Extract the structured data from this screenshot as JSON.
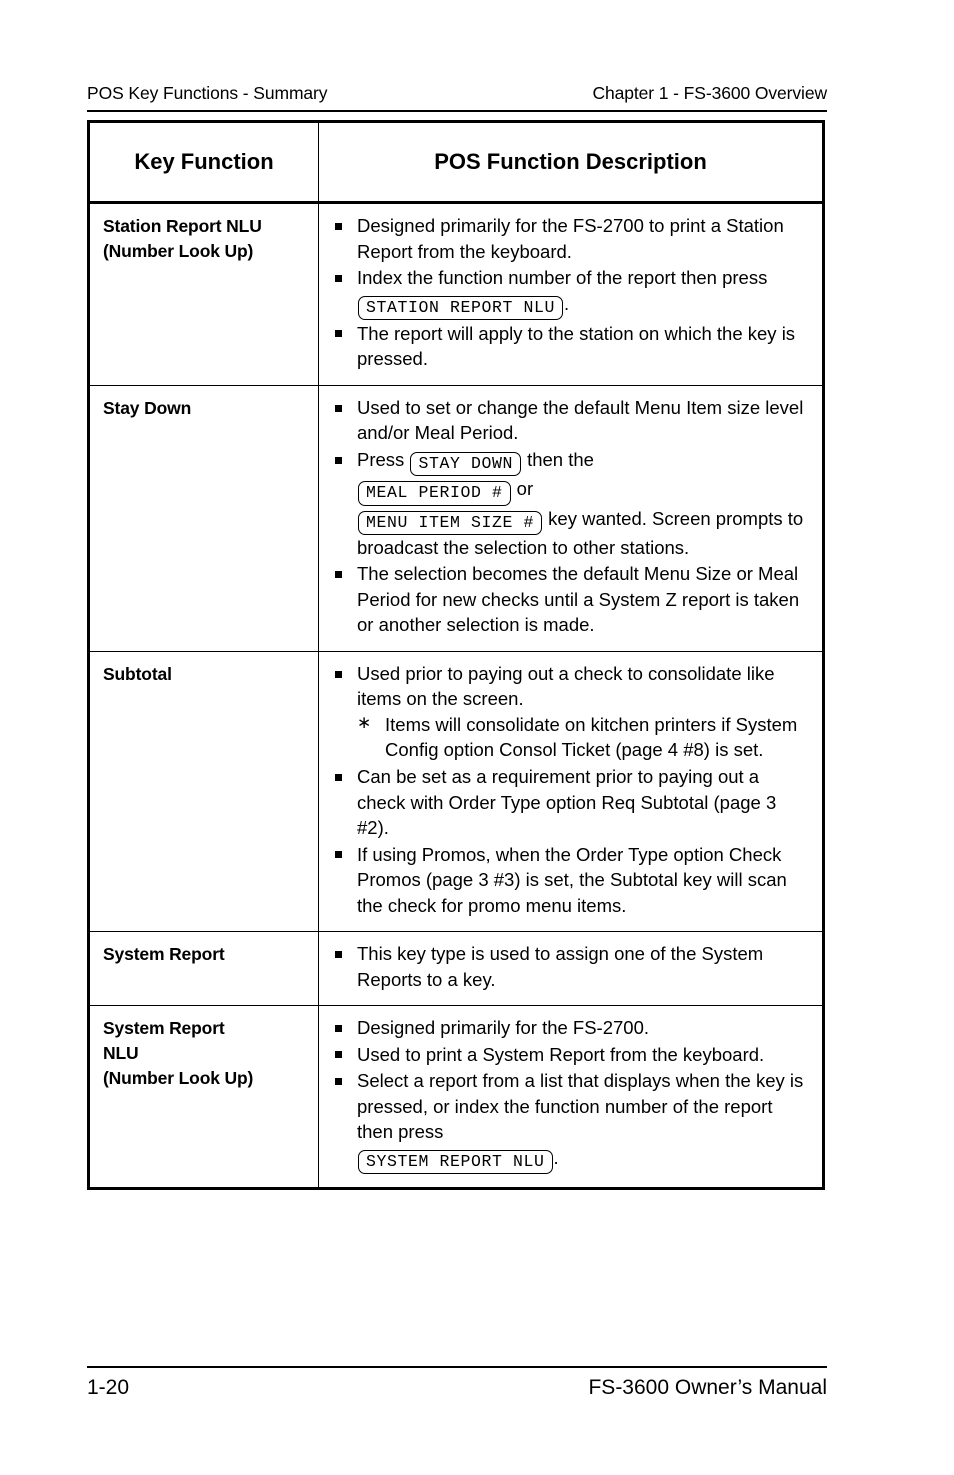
{
  "header": {
    "left": "POS Key Functions - Summary",
    "right": "Chapter 1 - FS-3600 Overview"
  },
  "table": {
    "columns": [
      "Key Function",
      "POS Function Description"
    ],
    "rows": [
      {
        "key_lines": [
          "Station Report NLU",
          "(Number Look Up)"
        ],
        "bullets": [
          {
            "type": "square",
            "segments": [
              {
                "t": "text",
                "v": "Designed primarily for the FS-2700 to print a Station Report from the keyboard."
              }
            ]
          },
          {
            "type": "square",
            "segments": [
              {
                "t": "text",
                "v": "Index the function number of the report then press "
              },
              {
                "t": "keycap",
                "v": "STATION REPORT NLU"
              },
              {
                "t": "text",
                "v": "."
              }
            ]
          },
          {
            "type": "square",
            "segments": [
              {
                "t": "text",
                "v": "The report will apply to the station on which the key is pressed."
              }
            ]
          }
        ]
      },
      {
        "key_lines": [
          "Stay Down"
        ],
        "bullets": [
          {
            "type": "square",
            "segments": [
              {
                "t": "text",
                "v": "Used to set or change the default Menu Item size level and/or Meal Period."
              }
            ]
          },
          {
            "type": "square",
            "segments": [
              {
                "t": "text",
                "v": "Press "
              },
              {
                "t": "keycap",
                "v": "STAY DOWN"
              },
              {
                "t": "text",
                "v": " then the"
              },
              {
                "t": "break",
                "v": ""
              },
              {
                "t": "keycap",
                "v": "MEAL PERIOD #"
              },
              {
                "t": "text",
                "v": " or"
              },
              {
                "t": "break",
                "v": ""
              },
              {
                "t": "keycap",
                "v": "MENU ITEM SIZE #"
              },
              {
                "t": "text",
                "v": " key wanted.  Screen prompts to broadcast the selection to other stations."
              }
            ]
          },
          {
            "type": "square",
            "segments": [
              {
                "t": "text",
                "v": "The selection becomes the default Menu Size or Meal Period for new checks until a System Z report is taken or another selection is made."
              }
            ]
          }
        ]
      },
      {
        "key_lines": [
          "Subtotal"
        ],
        "bullets": [
          {
            "type": "square",
            "segments": [
              {
                "t": "text",
                "v": "Used prior to paying out a check to consolidate like items on the screen."
              }
            ],
            "sub": [
              {
                "type": "asterisk",
                "segments": [
                  {
                    "t": "text",
                    "v": "Items will consolidate on kitchen printers if System Config option Consol Ticket (page 4 #8) is set."
                  }
                ]
              }
            ]
          },
          {
            "type": "square",
            "segments": [
              {
                "t": "text",
                "v": "Can be set as a requirement prior to paying out a check with Order Type option Req Subtotal (page 3 #2)."
              }
            ]
          },
          {
            "type": "square",
            "segments": [
              {
                "t": "text",
                "v": "If using Promos, when the Order Type option Check Promos (page 3 #3) is set, the Subtotal key will scan the check for promo menu items."
              }
            ]
          }
        ]
      },
      {
        "key_lines": [
          "System Report"
        ],
        "bullets": [
          {
            "type": "square",
            "segments": [
              {
                "t": "text",
                "v": "This key type is used to assign one of the System Reports to a key."
              }
            ]
          }
        ]
      },
      {
        "key_lines": [
          "System Report",
          "NLU",
          "(Number Look Up)"
        ],
        "bullets": [
          {
            "type": "square",
            "segments": [
              {
                "t": "text",
                "v": "Designed primarily for the FS-2700."
              }
            ]
          },
          {
            "type": "square",
            "segments": [
              {
                "t": "text",
                "v": "Used to print a System Report from the keyboard."
              }
            ]
          },
          {
            "type": "square",
            "segments": [
              {
                "t": "text",
                "v": "Select a report from a list that displays when the key is pressed, or index the function number of the report then press"
              },
              {
                "t": "break",
                "v": ""
              },
              {
                "t": "keycap",
                "v": "SYSTEM REPORT NLU"
              },
              {
                "t": "text",
                "v": "."
              }
            ]
          }
        ]
      }
    ]
  },
  "footer": {
    "page_number": "1-20",
    "manual_title": "FS-3600 Owner’s Manual"
  },
  "icons": {
    "bullet_square": "square-bullet-icon",
    "bullet_asterisk": "asterisk-bullet-icon"
  }
}
